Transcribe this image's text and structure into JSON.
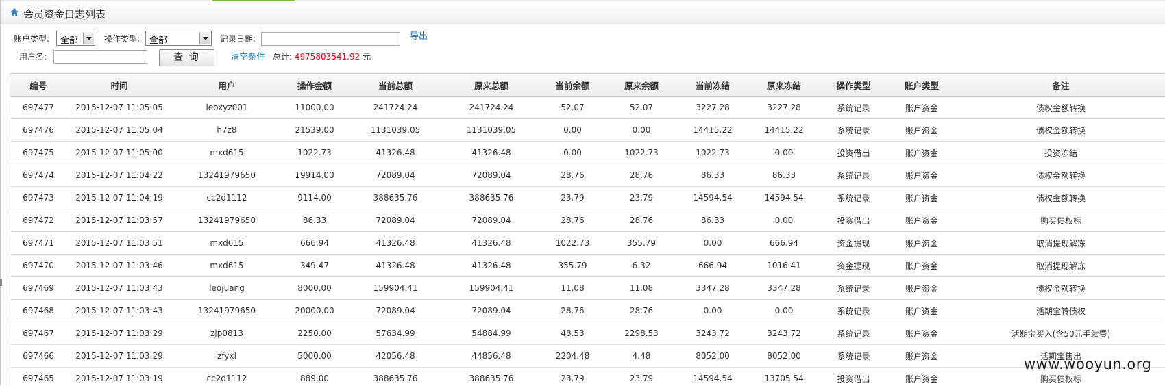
{
  "page": {
    "title": "会员资金日志列表",
    "home_icon": "home-icon"
  },
  "filters": {
    "account_type_label": "账户类型:",
    "account_type_value": "全部",
    "operation_type_label": "操作类型:",
    "operation_type_value": "全部",
    "record_date_label": "记录日期:",
    "record_date_value": "",
    "export_label": "导出",
    "username_label": "用户名:",
    "username_value": "",
    "query_label": "查 询",
    "clear_label": "清空条件",
    "total_label": "总计:",
    "total_value": "4975803541.92",
    "total_unit": "元"
  },
  "table": {
    "headers": [
      "编号",
      "时间",
      "用户",
      "操作金额",
      "当前总额",
      "原来总额",
      "当前余额",
      "原来余额",
      "当前冻结",
      "原来冻结",
      "操作类型",
      "账户类型",
      "备注"
    ],
    "rows": [
      [
        "697477",
        "2015-12-07 11:05:05",
        "leoxyz001",
        "11000.00",
        "241724.24",
        "241724.24",
        "52.07",
        "52.07",
        "3227.28",
        "3227.28",
        "系统记录",
        "账户资金",
        "债权金额转换"
      ],
      [
        "697476",
        "2015-12-07 11:05:04",
        "h7z8",
        "21539.00",
        "1131039.05",
        "1131039.05",
        "0.00",
        "0.00",
        "14415.22",
        "14415.22",
        "系统记录",
        "账户资金",
        "债权金额转换"
      ],
      [
        "697475",
        "2015-12-07 11:05:00",
        "mxd615",
        "1022.73",
        "41326.48",
        "41326.48",
        "0.00",
        "1022.73",
        "1022.73",
        "0.00",
        "投资借出",
        "账户资金",
        "投资冻结"
      ],
      [
        "697474",
        "2015-12-07 11:04:22",
        "13241979650",
        "19914.00",
        "72089.04",
        "72089.04",
        "28.76",
        "28.76",
        "86.33",
        "86.33",
        "系统记录",
        "账户资金",
        "债权金额转换"
      ],
      [
        "697473",
        "2015-12-07 11:04:19",
        "cc2d1112",
        "9114.00",
        "388635.76",
        "388635.76",
        "23.79",
        "23.79",
        "14594.54",
        "14594.54",
        "系统记录",
        "账户资金",
        "债权金额转换"
      ],
      [
        "697472",
        "2015-12-07 11:03:57",
        "13241979650",
        "86.33",
        "72089.04",
        "72089.04",
        "28.76",
        "28.76",
        "86.33",
        "0.00",
        "投资借出",
        "账户资金",
        "购买债权标"
      ],
      [
        "697471",
        "2015-12-07 11:03:51",
        "mxd615",
        "666.94",
        "41326.48",
        "41326.48",
        "1022.73",
        "355.79",
        "0.00",
        "666.94",
        "资金提现",
        "账户资金",
        "取消提现解冻"
      ],
      [
        "697470",
        "2015-12-07 11:03:46",
        "mxd615",
        "349.47",
        "41326.48",
        "41326.48",
        "355.79",
        "6.32",
        "666.94",
        "1016.41",
        "资金提现",
        "账户资金",
        "取消提现解冻"
      ],
      [
        "697469",
        "2015-12-07 11:03:43",
        "leojuang",
        "8000.00",
        "159904.41",
        "159904.41",
        "11.08",
        "11.08",
        "3347.28",
        "3347.28",
        "系统记录",
        "账户资金",
        "债权金额转换"
      ],
      [
        "697468",
        "2015-12-07 11:03:43",
        "13241979650",
        "20000.00",
        "72089.04",
        "72089.04",
        "28.76",
        "28.76",
        "0.00",
        "0.00",
        "系统记录",
        "账户资金",
        "活期宝转债权"
      ],
      [
        "697467",
        "2015-12-07 11:03:29",
        "zjp0813",
        "2250.00",
        "57634.99",
        "54884.99",
        "48.53",
        "2298.53",
        "3243.72",
        "3243.72",
        "系统记录",
        "账户资金",
        "活期宝买入(含50元手续费)"
      ],
      [
        "697466",
        "2015-12-07 11:03:29",
        "zfyxl",
        "5000.00",
        "42056.48",
        "44856.48",
        "2204.48",
        "4.48",
        "8052.00",
        "8052.00",
        "系统记录",
        "账户资金",
        "活期宝售出"
      ],
      [
        "697465",
        "2015-12-07 11:03:19",
        "cc2d1112",
        "889.00",
        "388635.76",
        "388635.76",
        "23.79",
        "23.79",
        "14594.54",
        "13705.54",
        "投资借出",
        "账户资金",
        "购买债权标"
      ]
    ]
  },
  "watermark": "www.wooyun.org"
}
